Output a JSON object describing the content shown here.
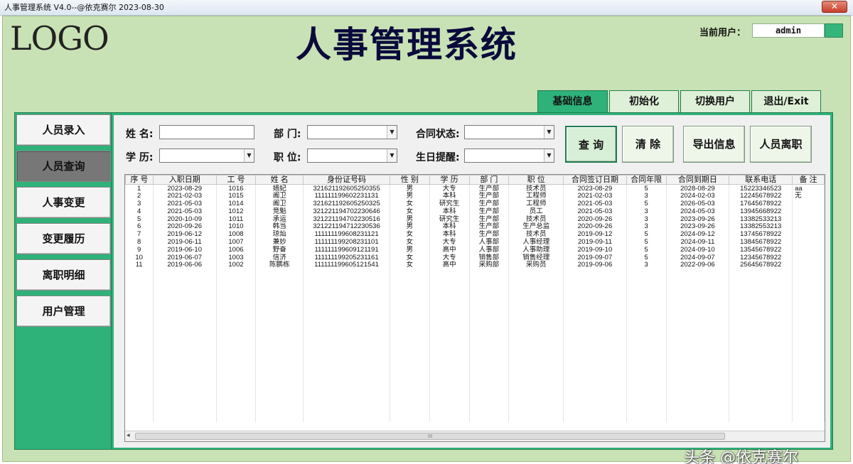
{
  "window": {
    "title": "人事管理系统 V4.0--@依克赛尔  2023-08-30",
    "close_glyph": "✕"
  },
  "header": {
    "logo": "LOGO",
    "app_title": "人事管理系统",
    "current_user_label": "当前用户：",
    "current_user": "admin"
  },
  "topnav": [
    {
      "label": "基础信息"
    },
    {
      "label": "初始化"
    },
    {
      "label": "切换用户"
    },
    {
      "label": "退出/Exit"
    }
  ],
  "sidebar": [
    {
      "label": "人员录入"
    },
    {
      "label": "人员查询"
    },
    {
      "label": "人事变更"
    },
    {
      "label": "变更履历"
    },
    {
      "label": "离职明细"
    },
    {
      "label": "用户管理"
    }
  ],
  "form": {
    "name_label": "姓  名:",
    "dept_label": "部  门:",
    "contract_label": "合同状态:",
    "edu_label": "学  历:",
    "position_label": "职  位:",
    "birthday_label": "生日提醒:",
    "name_value": "",
    "dept_value": "",
    "contract_value": "",
    "edu_value": "",
    "position_value": "",
    "birthday_value": ""
  },
  "buttons": {
    "query": "查 询",
    "clear": "清 除",
    "export": "导出信息",
    "resign": "人员离职"
  },
  "table": {
    "columns": [
      "序 号",
      "入职日期",
      "工 号",
      "姓 名",
      "身份证号码",
      "性 别",
      "学 历",
      "部 门",
      "职 位",
      "合同签订日期",
      "合同年限",
      "合同到期日",
      "联系电话",
      "备 注"
    ],
    "rows": [
      [
        "1",
        "2023-08-29",
        "1016",
        "嫱妃",
        "321621192605250355",
        "男",
        "大专",
        "生产部",
        "技术员",
        "2023-08-29",
        "5",
        "2028-08-29",
        "15223346523",
        "aa"
      ],
      [
        "2",
        "2021-02-03",
        "1015",
        "阖卫",
        "111111199602231131",
        "男",
        "本科",
        "生产部",
        "工程师",
        "2021-02-03",
        "3",
        "2024-02-03",
        "12245678922",
        "无"
      ],
      [
        "3",
        "2021-05-03",
        "1014",
        "阖卫",
        "321621192605250325",
        "女",
        "研究生",
        "生产部",
        "工程师",
        "2021-05-03",
        "5",
        "2026-05-03",
        "17645678922",
        ""
      ],
      [
        "4",
        "2021-05-03",
        "1012",
        "竞魁",
        "321221194702230646",
        "女",
        "本科",
        "生产部",
        "员工",
        "2021-05-03",
        "3",
        "2024-05-03",
        "13945668922",
        ""
      ],
      [
        "5",
        "2020-10-09",
        "1011",
        "承运",
        "321221194702230516",
        "男",
        "研究生",
        "生产部",
        "技术员",
        "2020-09-26",
        "3",
        "2023-09-26",
        "13382533213",
        ""
      ],
      [
        "6",
        "2020-09-26",
        "1010",
        "韩当",
        "321221194712230536",
        "男",
        "本科",
        "生产部",
        "生产总监",
        "2020-09-26",
        "3",
        "2023-09-26",
        "13382553213",
        ""
      ],
      [
        "7",
        "2019-06-12",
        "1008",
        "琼灿",
        "111111199608231121",
        "女",
        "本科",
        "生产部",
        "技术员",
        "2019-09-12",
        "5",
        "2024-09-12",
        "13745678922",
        ""
      ],
      [
        "8",
        "2019-06-11",
        "1007",
        "兼妙",
        "111111199208231101",
        "女",
        "大专",
        "人事部",
        "人事经理",
        "2019-09-11",
        "5",
        "2024-09-11",
        "13845678922",
        ""
      ],
      [
        "9",
        "2019-06-10",
        "1006",
        "野奋",
        "111111199609121191",
        "男",
        "高中",
        "人事部",
        "人事助理",
        "2019-09-10",
        "5",
        "2024-09-10",
        "13545678922",
        ""
      ],
      [
        "10",
        "2019-06-07",
        "1003",
        "信济",
        "111111199205231161",
        "女",
        "大专",
        "销售部",
        "销售经理",
        "2019-09-07",
        "5",
        "2024-09-07",
        "12345678922",
        ""
      ],
      [
        "11",
        "2019-06-06",
        "1002",
        "陈鹏栋",
        "111111199605121541",
        "女",
        "高中",
        "采购部",
        "采购员",
        "2019-09-06",
        "3",
        "2022-09-06",
        "25645678922",
        ""
      ]
    ],
    "scroll_left_glyph": "◂",
    "scroll_thumb_glyph": "III"
  },
  "watermark": "头条 @依克赛尔"
}
